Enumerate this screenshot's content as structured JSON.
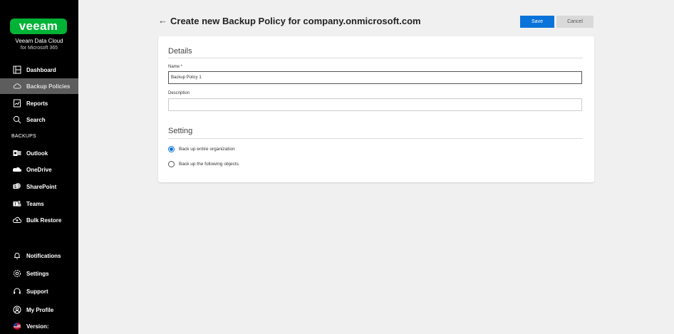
{
  "sidebar": {
    "logo": "veeam",
    "product_line1": "Veeam Data Cloud",
    "product_line2": "for Microsoft 365",
    "nav_top": [
      {
        "label": "Dashboard",
        "icon": "dashboard-icon"
      },
      {
        "label": "Backup Policies",
        "icon": "cloud-icon",
        "active": true
      },
      {
        "label": "Reports",
        "icon": "reports-icon"
      },
      {
        "label": "Search",
        "icon": "search-icon"
      }
    ],
    "backups_label": "BACKUPS",
    "nav_backups": [
      {
        "label": "Outlook",
        "icon": "outlook-icon"
      },
      {
        "label": "OneDrive",
        "icon": "onedrive-icon"
      },
      {
        "label": "SharePoint",
        "icon": "sharepoint-icon"
      },
      {
        "label": "Teams",
        "icon": "teams-icon"
      },
      {
        "label": "Bulk Restore",
        "icon": "restore-icon"
      }
    ],
    "nav_bottom": [
      {
        "label": "Notifications",
        "icon": "bell-icon"
      },
      {
        "label": "Settings",
        "icon": "gear-icon"
      },
      {
        "label": "Support",
        "icon": "support-icon"
      },
      {
        "label": "My Profile",
        "icon": "profile-icon"
      },
      {
        "label": "Version:",
        "icon": "flag-icon"
      }
    ]
  },
  "header": {
    "back_glyph": "←",
    "title": "Create new Backup Policy for company.onmicrosoft.com",
    "save_label": "Save",
    "cancel_label": "Cancel"
  },
  "details": {
    "section_title": "Details",
    "name_label": "Name *",
    "name_value": "Backup Policy 1",
    "description_label": "Description",
    "description_value": ""
  },
  "setting": {
    "section_title": "Setting",
    "options": [
      {
        "label": "Back up entire organization",
        "selected": true
      },
      {
        "label": "Back up the following objects",
        "selected": false
      }
    ]
  },
  "colors": {
    "brand_green": "#00b336",
    "accent_blue": "#0a73d9",
    "sidebar_bg": "#000000",
    "active_item_bg": "#5d5d5d"
  }
}
